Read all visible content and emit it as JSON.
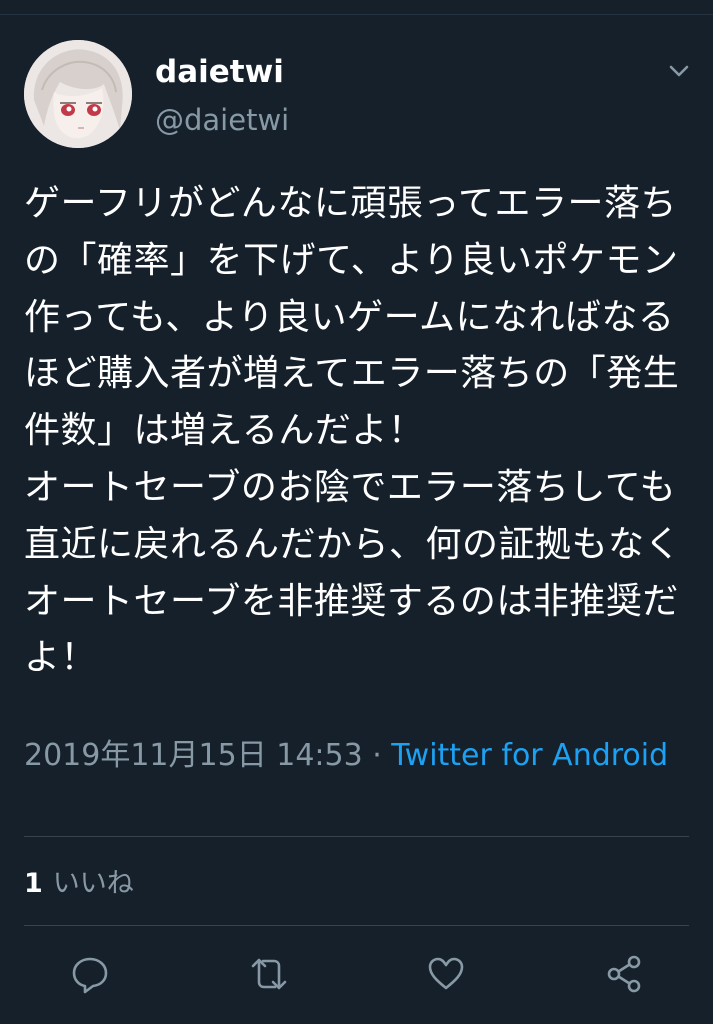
{
  "tweet": {
    "display_name": "daietwi",
    "handle": "@daietwi",
    "text": "ゲーフリがどんなに頑張ってエラー落ちの「確率」を下げて、より良いポケモン作っても、より良いゲームになればなるほど購入者が増えてエラー落ちの「発生件数」は増えるんだよ！\nオートセーブのお陰でエラー落ちしても直近に戻れるんだから、何の証拠もなくオートセーブを非推奨するのは非推奨だよ！",
    "timestamp": "2019年11月15日 14:53",
    "separator": " · ",
    "source": "Twitter for Android"
  },
  "stats": {
    "likes_count": "1",
    "likes_label": "いいね"
  },
  "icons": {
    "caret": "chevron-down-icon",
    "reply": "reply-icon",
    "retweet": "retweet-icon",
    "like": "heart-icon",
    "share": "share-icon"
  },
  "colors": {
    "background": "#15202b",
    "text": "#ffffff",
    "secondary": "#8899a6",
    "link": "#1da1f2",
    "divider": "#38444d"
  }
}
